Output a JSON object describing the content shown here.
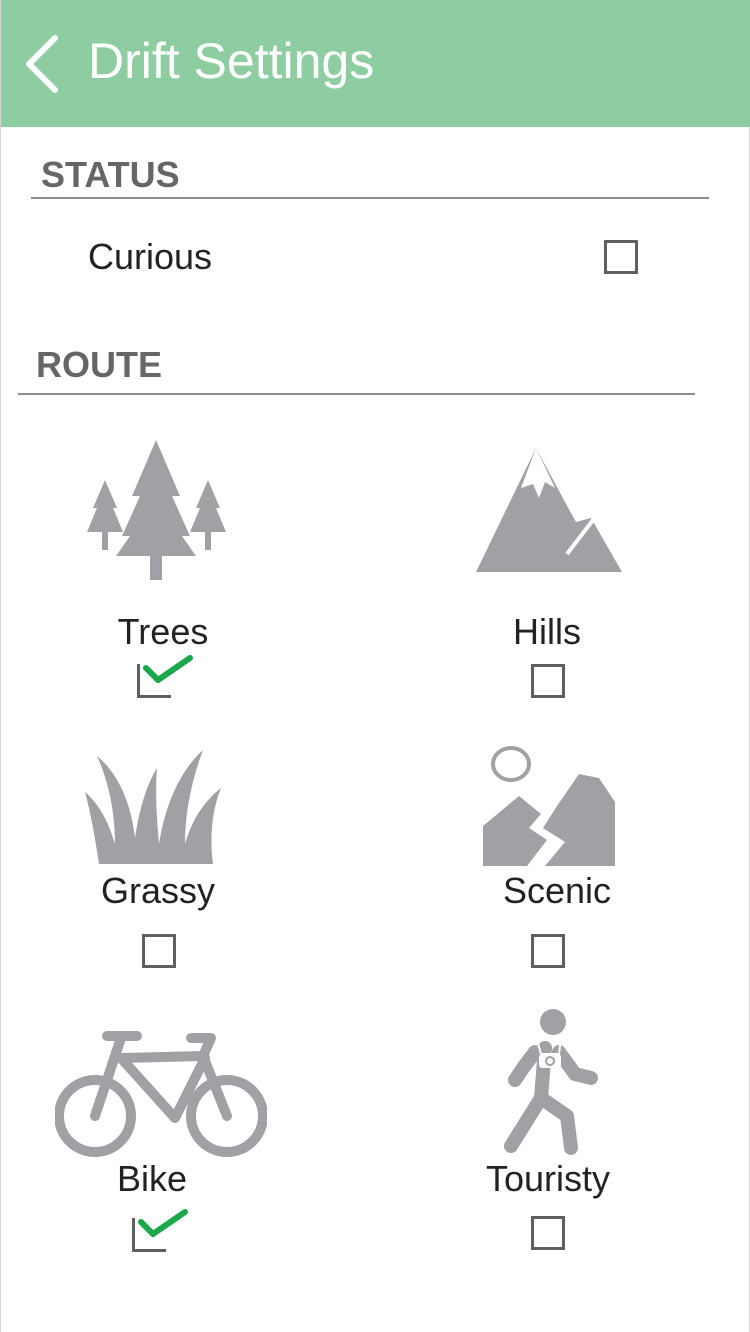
{
  "header": {
    "title": "Drift Settings",
    "back_icon": "chevron-left-icon"
  },
  "colors": {
    "header_bg": "#8dcda1",
    "icon_gray": "#a0a1a4",
    "check_green": "#1aa84a"
  },
  "status": {
    "section_title": "STATUS",
    "items": [
      {
        "label": "Curious",
        "checked": false
      }
    ]
  },
  "route": {
    "section_title": "ROUTE",
    "items": [
      {
        "label": "Trees",
        "icon": "trees-icon",
        "checked": true
      },
      {
        "label": "Hills",
        "icon": "mountain-icon",
        "checked": false
      },
      {
        "label": "Grassy",
        "icon": "grass-icon",
        "checked": false
      },
      {
        "label": "Scenic",
        "icon": "scenic-icon",
        "checked": false
      },
      {
        "label": "Bike",
        "icon": "bike-icon",
        "checked": true
      },
      {
        "label": "Touristy",
        "icon": "tourist-icon",
        "checked": false
      }
    ]
  }
}
